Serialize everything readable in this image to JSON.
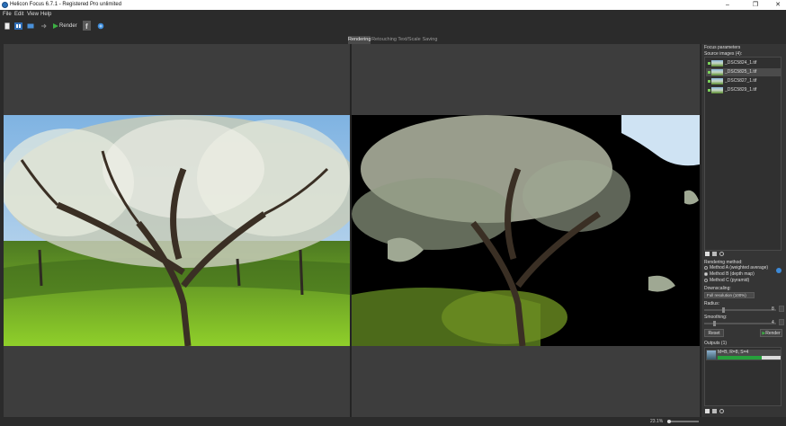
{
  "window": {
    "title": "Helicon Focus 6.7.1 - Registered Pro unlimited",
    "minimize": "–",
    "maximize": "❐",
    "close": "✕"
  },
  "menu": [
    "File",
    "Edit",
    "View",
    "Help"
  ],
  "toolbar": {
    "render_label": "Render",
    "icons": [
      "new-file-icon",
      "split-view-icon",
      "single-view-icon",
      "arrow-icon",
      "render-play-icon",
      "facebook-icon",
      "globe-icon"
    ]
  },
  "tabs": [
    {
      "label": "Rendering",
      "active": true
    },
    {
      "label": "Retouching",
      "active": false
    },
    {
      "label": "Text/Scale",
      "active": false
    },
    {
      "label": "Saving",
      "active": false
    }
  ],
  "right_panel": {
    "focus_parameters": "Focus parameters",
    "source_images_label": "Source images (4):",
    "source_images": [
      {
        "name": "_DSC5824_1.tif",
        "selected": false
      },
      {
        "name": "_DSC5825_1.tif",
        "selected": true
      },
      {
        "name": "_DSC5827_1.tif",
        "selected": false
      },
      {
        "name": "_DSC5829_1.tif",
        "selected": false
      }
    ],
    "rendering_method_label": "Rendering method:",
    "methods": [
      {
        "label": "Method A (weighted average)",
        "selected": false
      },
      {
        "label": "Method B (depth map)",
        "selected": true
      },
      {
        "label": "Method C (pyramid)",
        "selected": false
      }
    ],
    "downscaling_label": "Downscaling:",
    "downscaling_value": "Full resolution (100%)",
    "radius_label": "Radius:",
    "radius_value": "8",
    "smoothing_label": "Smoothing:",
    "smoothing_value": "4",
    "reset_label": "Reset",
    "render_label": "Render",
    "outputs_label": "Outputs (1)",
    "output_item": "M=B, R=8, S=4",
    "output_progress": 0.7
  },
  "status": {
    "zoom": "23.1%"
  },
  "colors": {
    "background": "#2b2b2b",
    "panel": "#353535",
    "pane": "#3d3d3d",
    "accent_green": "#27a03c",
    "brand_blue": "#2a6fb8"
  }
}
